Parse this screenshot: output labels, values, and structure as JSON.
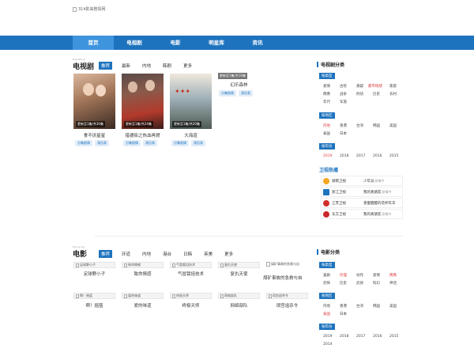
{
  "logo_alt": "314影来剧情网",
  "nav": [
    "首页",
    "电视剧",
    "电影",
    "明星库",
    "资讯"
  ],
  "tv_section": {
    "en": "Dianshiju",
    "title": "电视剧",
    "tabs": [
      "推荐",
      "最新",
      "内地",
      "韩剧",
      "更多"
    ],
    "items": [
      {
        "title": "食不厌星星",
        "ep": "更新至1集/共30集",
        "tags": [
          "分集剧情",
          "演员表"
        ]
      },
      {
        "title": "猎德街之热血再燃",
        "ep": "更新至1集/共24集",
        "tags": [
          "分集剧情",
          "演员表"
        ]
      },
      {
        "title": "大海道",
        "ep": "更新至1集/共20集",
        "tags": [
          "分集剧情",
          "演员表"
        ]
      },
      {
        "title": "幻乐森林",
        "ep": "更新至1集/共16集",
        "tags": [
          "分集剧情",
          "演员表"
        ]
      }
    ]
  },
  "tv_sidebar": {
    "title": "电视剧分类",
    "groups": [
      {
        "tag": "按类型",
        "rows": [
          [
            "爱情",
            "古装",
            "悬疑",
            "都市情感",
            "家庭"
          ],
          [
            "偶像",
            "战争",
            "刑侦",
            "历史",
            "农村"
          ],
          [
            "年代",
            "军旅"
          ]
        ]
      },
      {
        "tag": "按地区",
        "rows": [
          [
            "内地",
            "香港",
            "台湾",
            "韩国",
            "美国"
          ],
          [
            "泰国",
            "日本"
          ]
        ]
      },
      {
        "tag": "按年份",
        "rows": [
          [
            "2019",
            "2018",
            "2017",
            "2016",
            "2015"
          ]
        ]
      }
    ],
    "hot_title": "卫视热播",
    "hot": [
      {
        "channel": "湖南卫视",
        "show": "少年派",
        "tag": "剧情中"
      },
      {
        "channel": "浙江卫视",
        "show": "我的真朋友",
        "tag": "剧情中"
      },
      {
        "channel": "江苏卫视",
        "show": "香蜜醒醒的花杯年华",
        "tag": ""
      },
      {
        "channel": "东方卫视",
        "show": "我的真朋友",
        "tag": "剧情中"
      }
    ]
  },
  "movie_section": {
    "en": "Dianying",
    "title": "电影",
    "tabs": [
      "推荐",
      "环道",
      "内地",
      "港台",
      "日韩",
      "英美",
      "更多"
    ],
    "row1": [
      {
        "img": "足球野小子",
        "title": "足球野小子"
      },
      {
        "img": "致命情感",
        "title": "致命情感"
      },
      {
        "img": "气冒栽培技术",
        "title": "气冒栽培技术"
      },
      {
        "img": "复仇天使",
        "title": "复仇天使"
      }
    ],
    "big": {
      "img": "煤矿事故的急救与自",
      "title": "煤矿事故的急救与自"
    },
    "row2": [
      {
        "img": "啊！摇篮",
        "title": "啊！摇篮"
      },
      {
        "img": "爱的味道",
        "title": "爱的味道"
      },
      {
        "img": "终极天师",
        "title": "终极天师"
      },
      {
        "img": "网络部队",
        "title": "网络部队"
      },
      {
        "img": "琐宫追杀令",
        "title": "琐宫追杀令"
      }
    ]
  },
  "movie_sidebar": {
    "title": "电影分类",
    "groups": [
      {
        "tag": "按类型",
        "rows": [
          [
            "喜剧",
            "伦理",
            "动作",
            "爱情",
            "偶像"
          ],
          [
            "恐怖",
            "历史",
            "武侠",
            "科幻",
            "神话"
          ]
        ]
      },
      {
        "tag": "按地区",
        "rows": [
          [
            "内地",
            "香港",
            "台湾",
            "韩国",
            "美国"
          ],
          [
            "泰国",
            "日本"
          ]
        ]
      },
      {
        "tag": "按年份",
        "rows": [
          [
            "2019",
            "2018",
            "2017",
            "2016",
            "2015"
          ],
          [
            "2014"
          ]
        ]
      }
    ]
  }
}
